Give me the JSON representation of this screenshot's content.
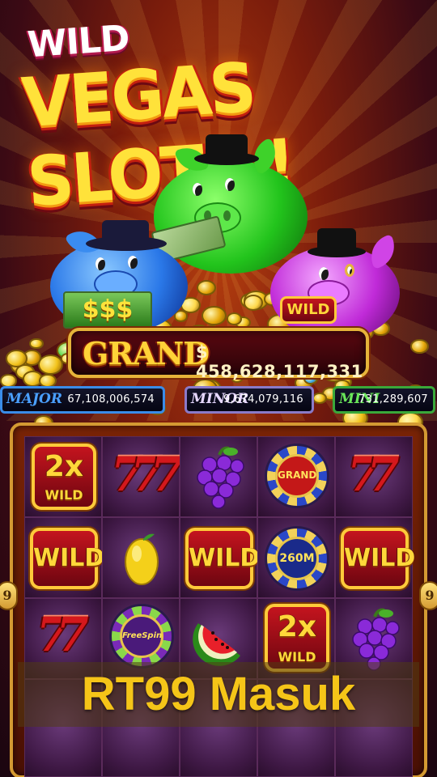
{
  "title": {
    "wild": "WILD",
    "main": "VEGAS SLOTS !"
  },
  "jackpots": {
    "grand": {
      "label": "GRAND",
      "value": "$ 458,628,117,331"
    },
    "major": {
      "label": "MAJOR",
      "value": "67,108,006,574"
    },
    "minor": {
      "label": "MINOR",
      "value": "9,674,079,116"
    },
    "mini": {
      "label": "MINI",
      "value": "731,289,607"
    }
  },
  "pigs": {
    "left_sign": "$$$",
    "right_sign": "WILD"
  },
  "reel_side_numbers": {
    "left": "9",
    "right": "9"
  },
  "reels": {
    "row1": [
      "2x WILD",
      "7",
      "grapes",
      "GRAND",
      "7"
    ],
    "row2": [
      "WILD",
      "lemon",
      "WILD",
      "260M",
      "WILD"
    ],
    "row3": [
      "7",
      "FreeSpin",
      "watermelon",
      "2x WILD",
      "grapes"
    ]
  },
  "symbol_text": {
    "wild": "WILD",
    "mult": "2x",
    "grand_chip": "GRAND",
    "prize_chip": "260M",
    "freespin": "FreeSpin",
    "seven": "7"
  },
  "caption": "RT99 Masuk",
  "colors": {
    "gold": "#ffd338",
    "caption": "#f5c518",
    "major": "#3a8ce8",
    "minor": "#e0d0ff",
    "mini": "#5ad84a"
  }
}
